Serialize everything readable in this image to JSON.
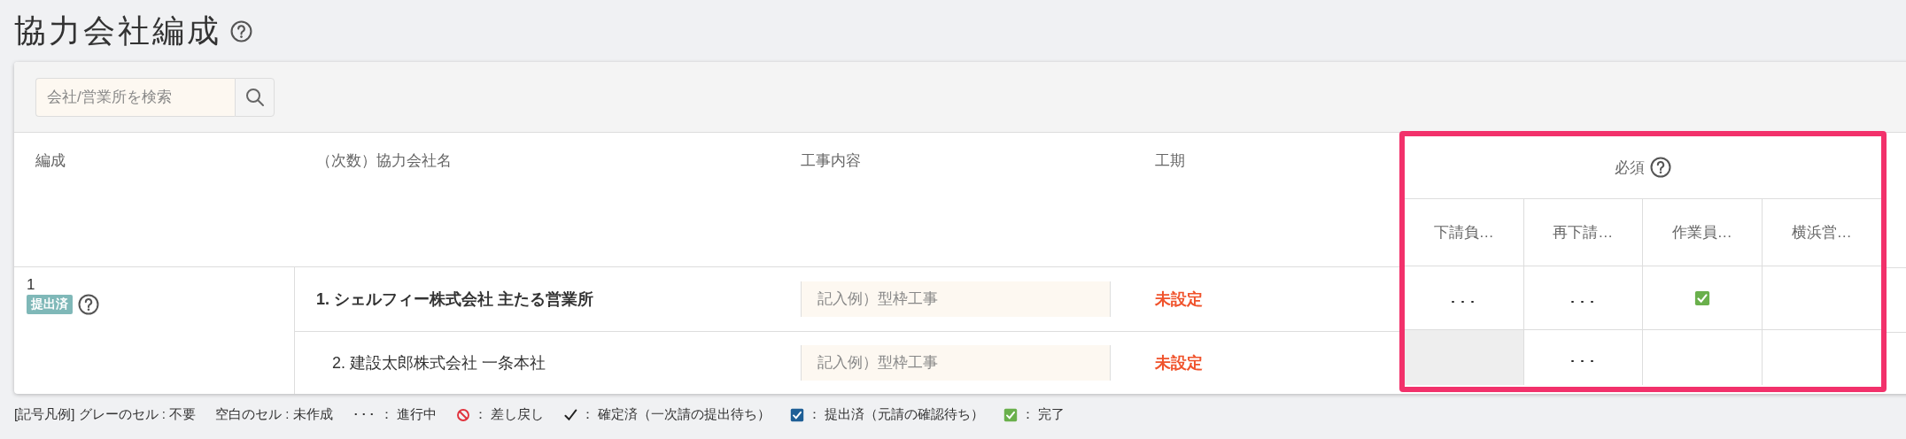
{
  "page": {
    "title": "協力会社編成"
  },
  "search": {
    "placeholder": "会社/営業所を検索"
  },
  "table": {
    "columns": [
      "編成",
      "（次数）協力会社名",
      "工事内容",
      "工期"
    ],
    "required_group": {
      "label": "必須",
      "columns": [
        "下請負…",
        "再下請…",
        "作業員…",
        "横浜営…"
      ]
    },
    "group": {
      "number": "1",
      "badge": "提出済"
    },
    "rows": [
      {
        "company": "1. シェルフィー株式会社 主たる営業所",
        "primary": true,
        "work_placeholder": "記入例）型枠工事",
        "period": "未設定",
        "cells": [
          {
            "kind": "progress",
            "text": "･･･"
          },
          {
            "kind": "progress",
            "text": "･･･"
          },
          {
            "kind": "complete"
          },
          {
            "kind": "empty"
          }
        ]
      },
      {
        "company": "2. 建設太郎株式会社 一条本社",
        "primary": false,
        "work_placeholder": "記入例）型枠工事",
        "period": "未設定",
        "cells": [
          {
            "kind": "gray"
          },
          {
            "kind": "progress",
            "text": "･･･"
          },
          {
            "kind": "empty"
          },
          {
            "kind": "empty"
          }
        ]
      }
    ]
  },
  "legend": [
    {
      "kind": "text",
      "label": "[記号凡例] グレーのセル : 不要"
    },
    {
      "kind": "text",
      "label": "空白のセル : 未作成"
    },
    {
      "kind": "progress",
      "symbol": "･･･",
      "label": "：  進行中"
    },
    {
      "kind": "returned",
      "label": "：  差し戻し"
    },
    {
      "kind": "confirmed",
      "label": "：  確定済（一次請の提出待ち）"
    },
    {
      "kind": "submitted",
      "label": "：  提出済（元請の確認待ち）"
    },
    {
      "kind": "complete",
      "label": "：  完了"
    }
  ]
}
